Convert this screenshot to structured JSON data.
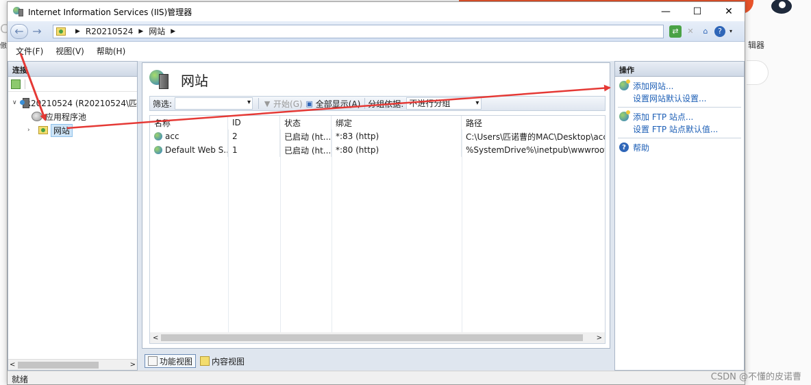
{
  "window": {
    "title": "Internet Information Services (IIS)管理器",
    "minimize": "—",
    "maximize": "☐",
    "close": "✕"
  },
  "address": {
    "back": "←",
    "forward": "→",
    "crumbs": [
      "R20210524",
      "网站"
    ],
    "sep": "▶"
  },
  "menu": [
    "文件(F)",
    "视图(V)",
    "帮助(H)"
  ],
  "connections": {
    "header": "连接",
    "server": "R20210524 (R20210524\\匹",
    "pool": "应用程序池",
    "sites": "网站",
    "collapse": "∨",
    "expand": "›"
  },
  "content": {
    "title": "网站",
    "filter_label": "筛选:",
    "start": "开始(G)",
    "show_all": "全部显示(A)",
    "group_by": "分组依据:",
    "group_value": "不进行分组",
    "columns": [
      "名称",
      "ID",
      "状态",
      "绑定",
      "路径"
    ],
    "rows": [
      {
        "name": "acc",
        "id": "2",
        "status": "已启动 (ht...",
        "binding": "*:83 (http)",
        "path": "C:\\Users\\匹诺曹的MAC\\Desktop\\acc"
      },
      {
        "name": "Default Web S...",
        "id": "1",
        "status": "已启动 (ht...",
        "binding": "*:80 (http)",
        "path": "%SystemDrive%\\inetpub\\wwwroot"
      }
    ],
    "view_tabs": [
      "功能视图",
      "内容视图"
    ]
  },
  "actions": {
    "header": "操作",
    "add_site": "添加网站...",
    "site_defaults": "设置网站默认设置...",
    "add_ftp": "添加 FTP 站点...",
    "ftp_defaults": "设置 FTP 站点默认值...",
    "help": "帮助"
  },
  "status": "就绪",
  "watermark": "CSDN @不懂的皮诺曹",
  "background": {
    "right_text": "辑器",
    "left_text": "傲",
    "left_glyph": "C"
  },
  "colors": {
    "accent": "#1d5fb6",
    "arrow": "#e53935"
  }
}
